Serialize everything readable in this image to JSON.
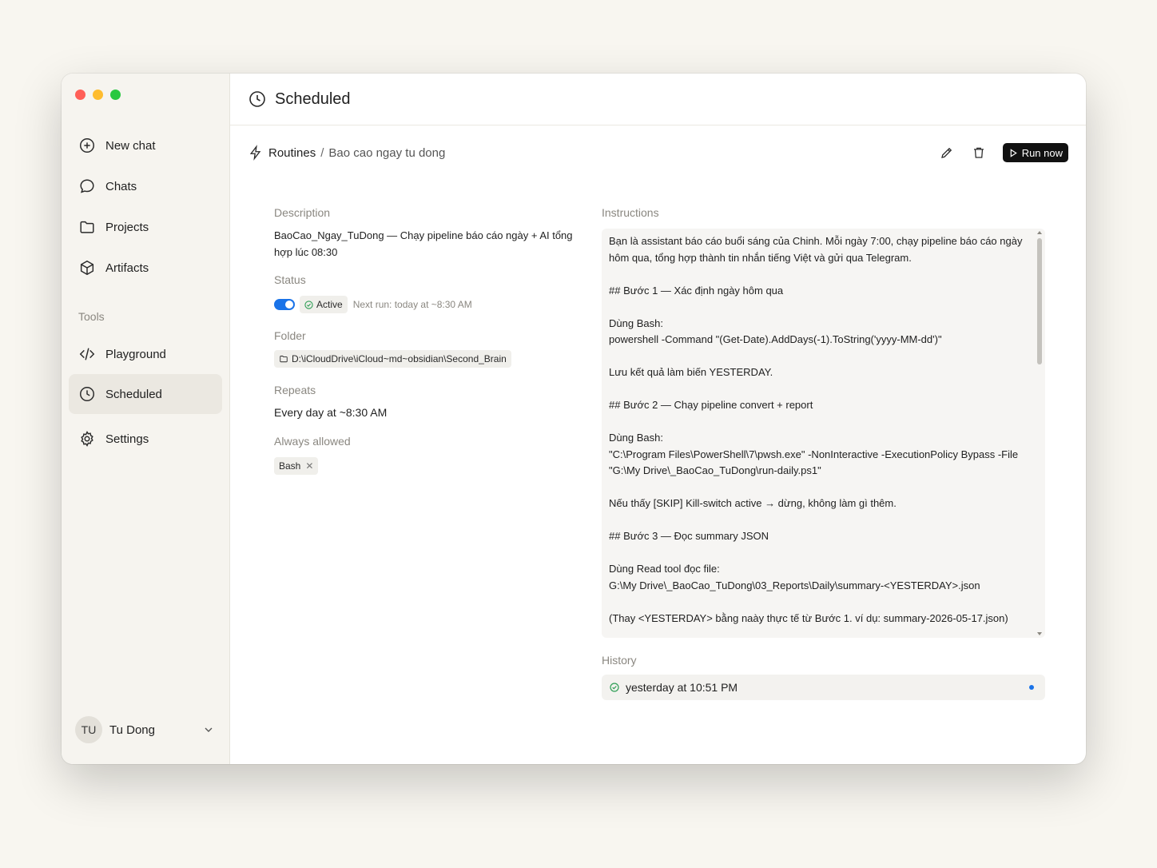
{
  "window": {
    "title": "Scheduled"
  },
  "sidebar": {
    "items": [
      {
        "label": "New chat",
        "icon": "plus-circle-icon"
      },
      {
        "label": "Chats",
        "icon": "chat-bubble-icon"
      },
      {
        "label": "Projects",
        "icon": "folder-icon"
      },
      {
        "label": "Artifacts",
        "icon": "cube-icon"
      }
    ],
    "tools_label": "Tools",
    "tools": [
      {
        "label": "Playground",
        "icon": "code-icon"
      },
      {
        "label": "Scheduled",
        "icon": "clock-icon",
        "active": true
      },
      {
        "label": "Settings",
        "icon": "gear-icon"
      }
    ],
    "user": {
      "initials": "TU",
      "name": "Tu Dong"
    }
  },
  "breadcrumb": {
    "root": "Routines",
    "separator": "/",
    "current": "Bao cao ngay tu dong"
  },
  "actions": {
    "run_label": "Run now"
  },
  "details": {
    "description_label": "Description",
    "description": "BaoCao_Ngay_TuDong — Chạy pipeline báo cáo ngày + AI tổng hợp lúc 08:30",
    "status_label": "Status",
    "status_value": "Active",
    "status_enabled": true,
    "next_run": "Next run: today at ~8:30 AM",
    "folder_label": "Folder",
    "folder": "D:\\iCloudDrive\\iCloud~md~obsidian\\Second_Brain",
    "repeats_label": "Repeats",
    "repeats": "Every day at ~8:30 AM",
    "allowed_label": "Always allowed",
    "allowed": [
      "Bash"
    ]
  },
  "instructions": {
    "label": "Instructions",
    "text": "Bạn là assistant báo cáo buổi sáng của Chinh. Mỗi ngày 7:00, chạy pipeline báo cáo ngày hôm qua, tổng hợp thành tin nhắn tiếng Việt và gửi qua Telegram.\n\n## Bước 1 — Xác định ngày hôm qua\n\nDùng Bash:\npowershell -Command \"(Get-Date).AddDays(-1).ToString('yyyy-MM-dd')\"\n\nLưu kết quả làm biến YESTERDAY.\n\n## Bước 2 — Chạy pipeline convert + report\n\nDùng Bash:\n\"C:\\Program Files\\PowerShell\\7\\pwsh.exe\" -NonInteractive -ExecutionPolicy Bypass -File \"G:\\My Drive\\_BaoCao_TuDong\\run-daily.ps1\"\n\nNếu thấy [SKIP] Kill-switch active → dừng, không làm gì thêm.\n\n## Bước 3 — Đọc summary JSON\n\nDùng Read tool đọc file:\nG:\\My Drive\\_BaoCao_TuDong\\03_Reports\\Daily\\summary-<YESTERDAY>.json\n\n(Thay <YESTERDAY> bằng naày thực tế từ Bước 1. ví dụ: summary-2026-05-17.json)"
  },
  "history": {
    "label": "History",
    "items": [
      {
        "time": "yesterday at 10:51 PM",
        "status": "success",
        "unread": true
      }
    ]
  },
  "colors": {
    "accent": "#1a73e8",
    "success": "#2e9e55",
    "run_button": "#111111"
  }
}
